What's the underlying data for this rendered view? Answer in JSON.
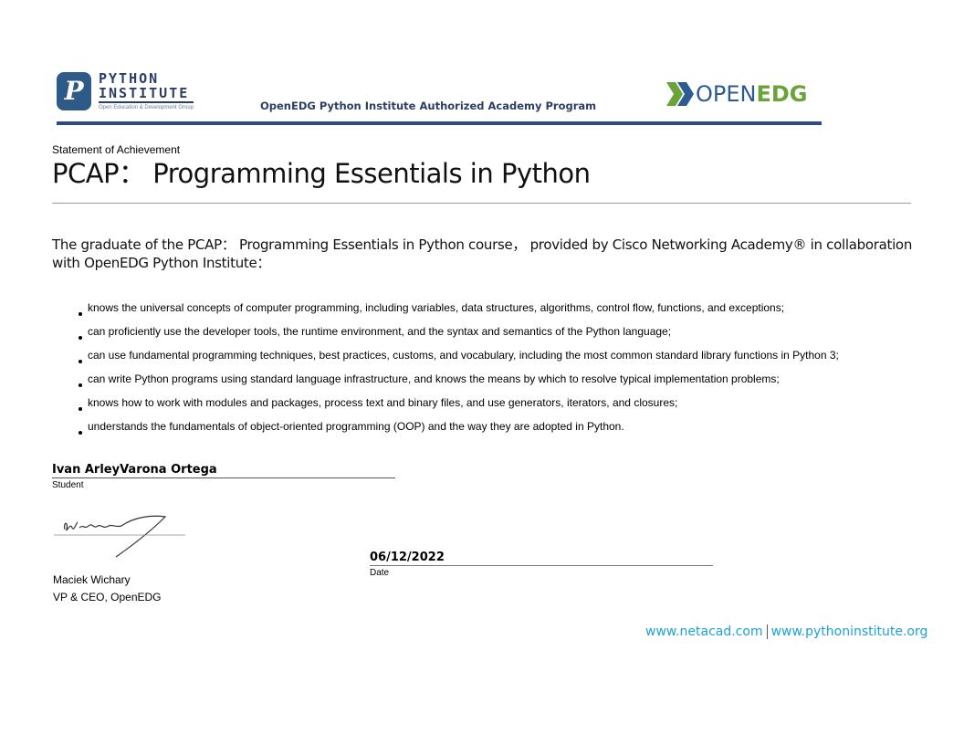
{
  "header": {
    "pi_logo": {
      "letter": "P",
      "line1": "PYTHON",
      "line2": "INSTITUTE",
      "tagline": "Open Education & Development Group"
    },
    "program_title": "OpenEDG Python Institute Authorized Academy Program",
    "edg_logo": {
      "word_open": "OPEN",
      "word_edg": "EDG"
    }
  },
  "certificate": {
    "statement_label": "Statement of Achievement",
    "course_title": "PCAP： Programming Essentials in Python",
    "intro": "The graduate of the PCAP： Programming Essentials in Python course， provided by Cisco Networking Academy® in collaboration with OpenEDG Python Institute：",
    "skills": [
      "knows the universal concepts of computer programming, including variables, data structures, algorithms, control flow, functions, and exceptions;",
      "can proficiently use the developer tools, the runtime environment, and the syntax and semantics of the Python language;",
      "can use fundamental programming techniques, best practices, customs, and vocabulary, including the most common standard library functions in Python 3;",
      "can write Python programs using standard language infrastructure, and knows the means by which to resolve typical implementation problems;",
      "knows how to work with modules and packages, process text and binary files, and use generators, iterators, and closures;",
      "understands the fundamentals of object-oriented programming (OOP) and the way they are adopted in Python."
    ]
  },
  "student": {
    "name": "Ivan ArleyVarona Ortega",
    "label": "Student"
  },
  "signer": {
    "name": "Maciek Wichary",
    "role": "VP & CEO, OpenEDG"
  },
  "date": {
    "value": "06/12/2022",
    "label": "Date"
  },
  "footer": {
    "link1": "www.netacad.com",
    "link2": "www.pythoninstitute.org"
  },
  "colors": {
    "brand_navy": "#2c4b80",
    "brand_green": "#6aa33a",
    "link_blue": "#1da1d6",
    "accent_yellow": "#f2b21b"
  }
}
